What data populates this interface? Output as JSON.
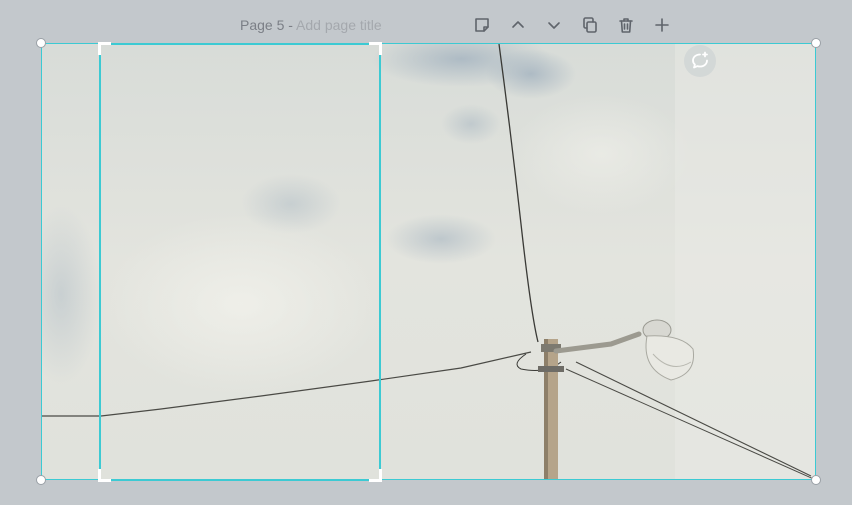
{
  "page": {
    "label": "Page 5",
    "separator": " - ",
    "title_placeholder": "Add page title"
  },
  "toolbar": {
    "items": [
      {
        "name": "notes",
        "icon": "sticky-note-icon"
      },
      {
        "name": "move-up",
        "icon": "chevron-up-icon"
      },
      {
        "name": "move-down",
        "icon": "chevron-down-icon"
      },
      {
        "name": "duplicate",
        "icon": "copy-icon"
      },
      {
        "name": "delete",
        "icon": "trash-icon"
      },
      {
        "name": "add-page",
        "icon": "plus-icon"
      }
    ]
  },
  "canvas": {
    "image": "overcast sky with utility pole, street lamp and power lines",
    "comment_icon": "add-comment-icon"
  },
  "colors": {
    "workspace_bg": "#c3c8cc",
    "selection": "#3ccad3",
    "icon": "#5f646b",
    "title_text": "#7b7f86",
    "placeholder_text": "#a4a8ad"
  }
}
